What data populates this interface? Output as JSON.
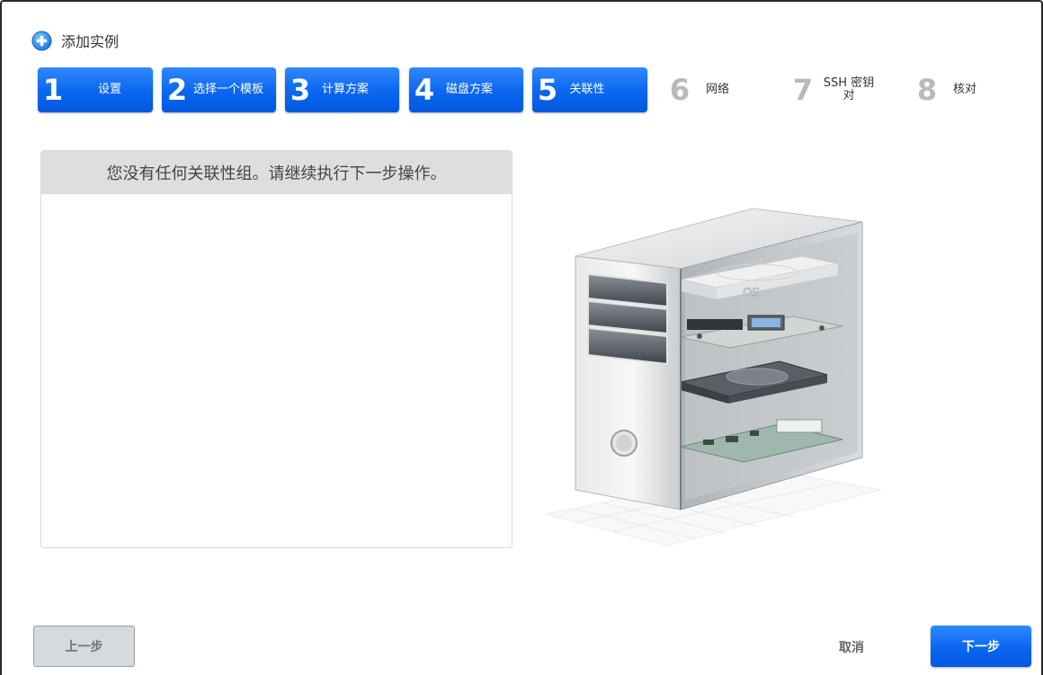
{
  "dialog": {
    "title": "添加实例",
    "icon": "plus-circle-icon"
  },
  "steps": [
    {
      "number": "1",
      "label": "设置",
      "state": "active"
    },
    {
      "number": "2",
      "label": "选择一个模板",
      "state": "active"
    },
    {
      "number": "3",
      "label": "计算方案",
      "state": "active"
    },
    {
      "number": "4",
      "label": "磁盘方案",
      "state": "active"
    },
    {
      "number": "5",
      "label": "关联性",
      "state": "active"
    },
    {
      "number": "6",
      "label": "网络",
      "state": "inactive"
    },
    {
      "number": "7",
      "label": "SSH 密钥对",
      "state": "inactive"
    },
    {
      "number": "8",
      "label": "核对",
      "state": "inactive"
    }
  ],
  "affinity_panel": {
    "message": "您没有任何关联性组。请继续执行下一步操作。"
  },
  "illustration": {
    "os_label": "OS",
    "icon": "server-tower-illustration"
  },
  "footer": {
    "prev_label": "上一步",
    "cancel_label": "取消",
    "next_label": "下一步"
  },
  "colors": {
    "accent": "#0a66f0",
    "inactive_step_number": "#b9b9b9",
    "panel_header_bg": "#dedede"
  }
}
